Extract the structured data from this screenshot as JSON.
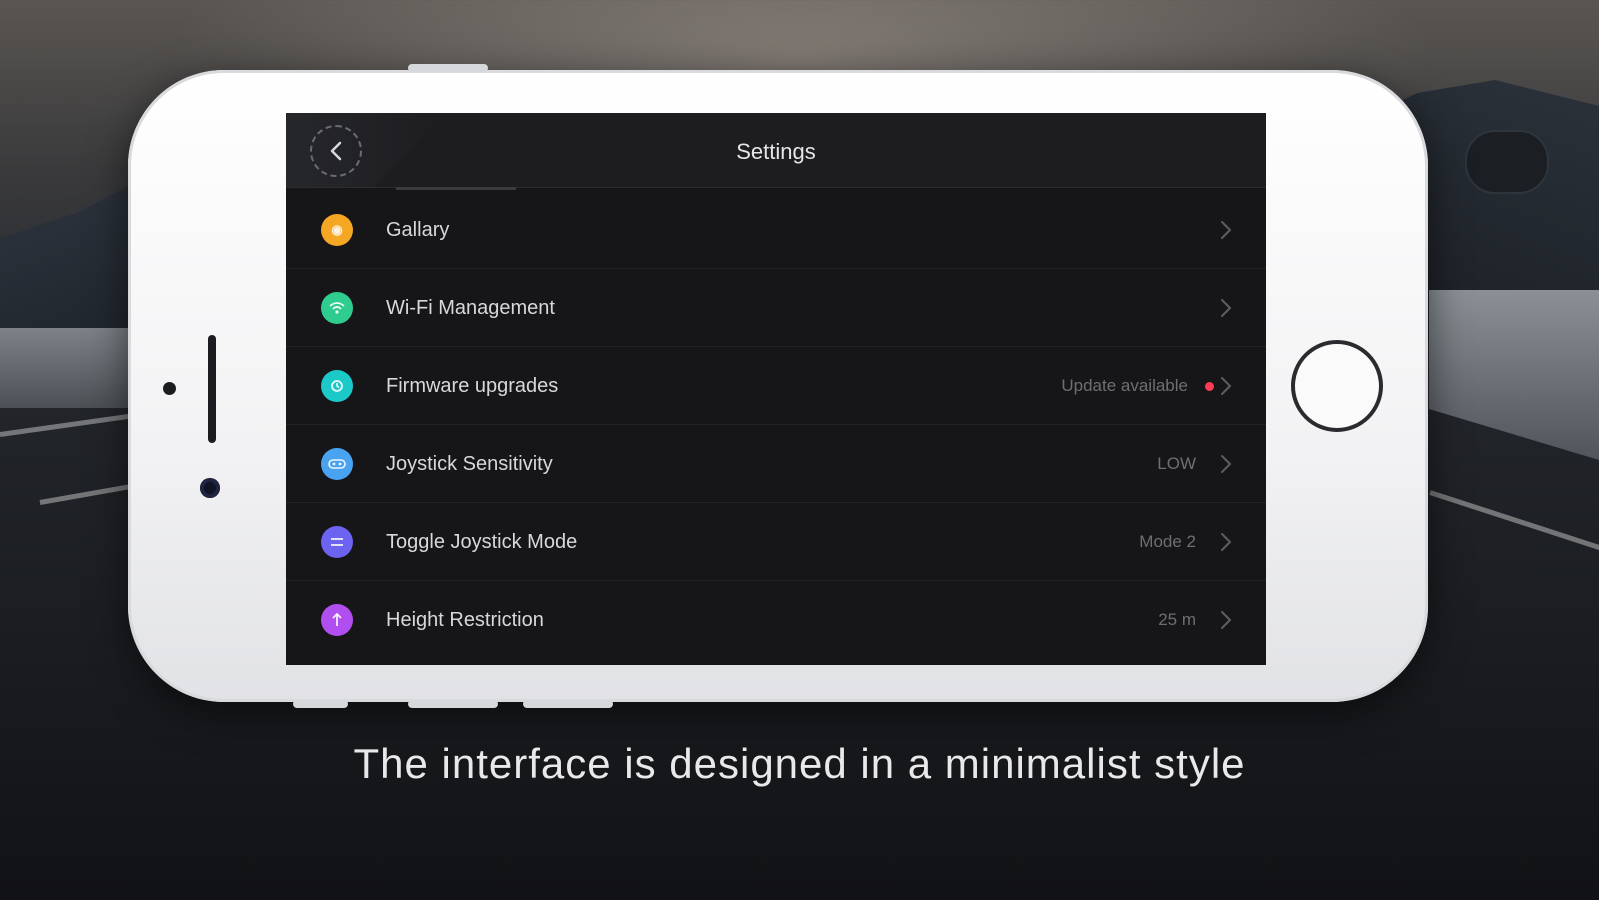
{
  "screen": {
    "title": "Settings",
    "back_icon": "chevron-left-icon"
  },
  "settings": {
    "items": [
      {
        "label": "Gallary",
        "value": "",
        "icon": "gallery-icon",
        "color": "#f5a623"
      },
      {
        "label": "Wi-Fi Management",
        "value": "",
        "icon": "wifi-icon",
        "color": "#2ecc8f"
      },
      {
        "label": "Firmware upgrades",
        "value": "Update available",
        "icon": "firmware-icon",
        "color": "#1cc9c9",
        "badge_color": "#ff3b55"
      },
      {
        "label": "Joystick Sensitivity",
        "value": "LOW",
        "icon": "joystick-icon",
        "color": "#4aa3f0"
      },
      {
        "label": "Toggle Joystick Mode",
        "value": "Mode 2",
        "icon": "mode-icon",
        "color": "#6c63f0"
      },
      {
        "label": "Height Restriction",
        "value": "25 m",
        "icon": "height-icon",
        "color": "#b04ef0"
      }
    ]
  },
  "caption": "The interface is designed in a minimalist style"
}
